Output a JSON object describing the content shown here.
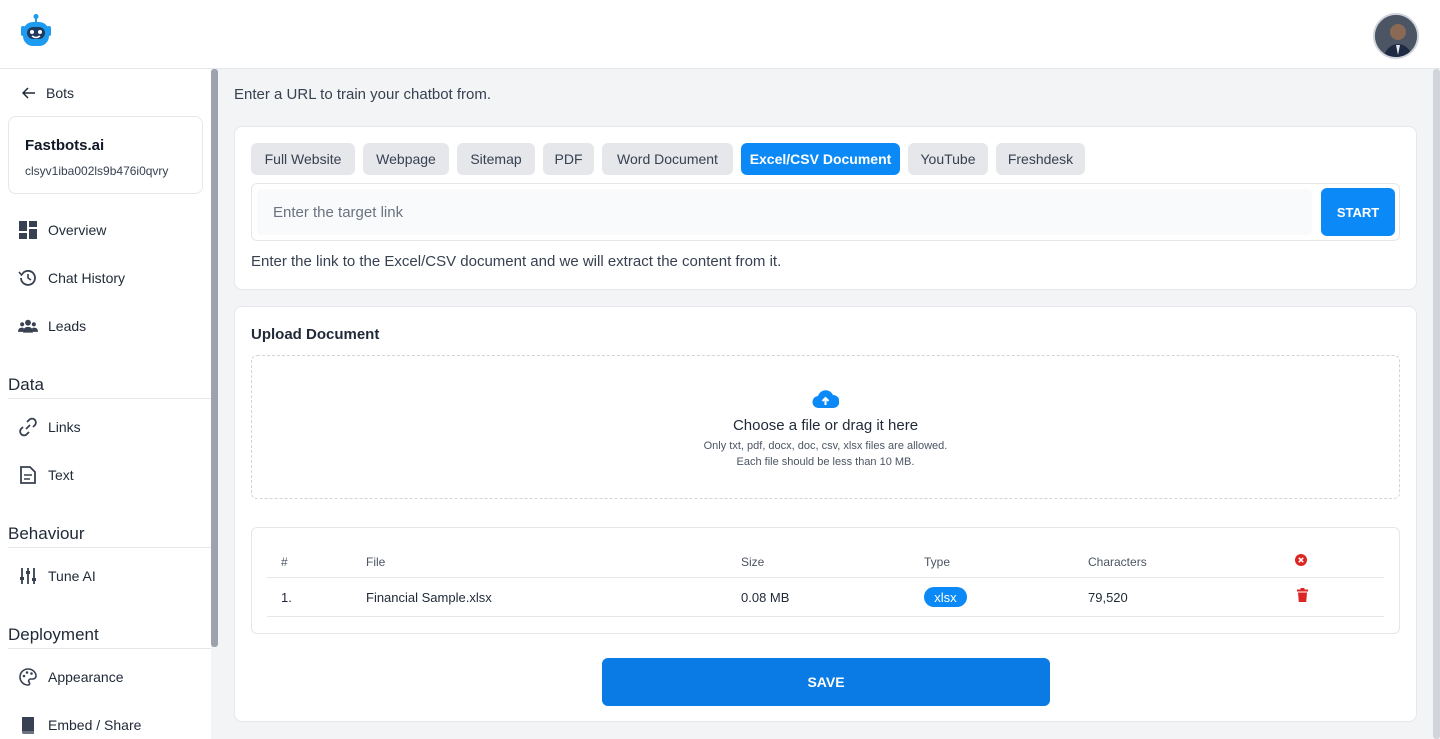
{
  "header": {
    "logo_icon": "robot-logo-icon",
    "avatar_icon": "user-avatar"
  },
  "sidebar": {
    "back_label": "Bots",
    "bot": {
      "name": "Fastbots.ai",
      "id": "clsyv1iba002ls9b476i0qvry"
    },
    "items_top": [
      {
        "label": "Overview",
        "icon": "grid-icon"
      },
      {
        "label": "Chat History",
        "icon": "history-icon"
      },
      {
        "label": "Leads",
        "icon": "users-icon"
      }
    ],
    "sections": [
      {
        "title": "Data",
        "items": [
          {
            "label": "Links",
            "icon": "link-icon"
          },
          {
            "label": "Text",
            "icon": "document-icon"
          }
        ]
      },
      {
        "title": "Behaviour",
        "items": [
          {
            "label": "Tune AI",
            "icon": "sliders-icon"
          }
        ]
      },
      {
        "title": "Deployment",
        "items": [
          {
            "label": "Appearance",
            "icon": "palette-icon"
          },
          {
            "label": "Embed / Share",
            "icon": "book-icon"
          }
        ]
      }
    ]
  },
  "main": {
    "intro": "Enter a URL to train your chatbot from.",
    "tabs": [
      {
        "label": "Full Website",
        "active": false
      },
      {
        "label": "Webpage",
        "active": false
      },
      {
        "label": "Sitemap",
        "active": false
      },
      {
        "label": "PDF",
        "active": false
      },
      {
        "label": "Word Document",
        "active": false
      },
      {
        "label": "Excel/CSV Document",
        "active": true
      },
      {
        "label": "YouTube",
        "active": false
      },
      {
        "label": "Freshdesk",
        "active": false
      }
    ],
    "url_input": {
      "placeholder": "Enter the target link",
      "value": ""
    },
    "start_label": "START",
    "hint": "Enter the link to the Excel/CSV document and we will extract the content from it.",
    "upload": {
      "title": "Upload Document",
      "main": "Choose a file or drag it here",
      "sub1": "Only txt, pdf, docx, doc, csv, xlsx files are allowed.",
      "sub2": "Each file should be less than 10 MB."
    },
    "table": {
      "headers": [
        "#",
        "File",
        "Size",
        "Type",
        "Characters"
      ],
      "rows": [
        {
          "num": "1.",
          "file": "Financial Sample.xlsx",
          "size": "0.08 MB",
          "type": "xlsx",
          "characters": "79,520"
        }
      ]
    },
    "save_label": "SAVE"
  },
  "colors": {
    "accent": "#0b8af7",
    "save": "#0a7ae5",
    "danger": "#dc2626"
  }
}
